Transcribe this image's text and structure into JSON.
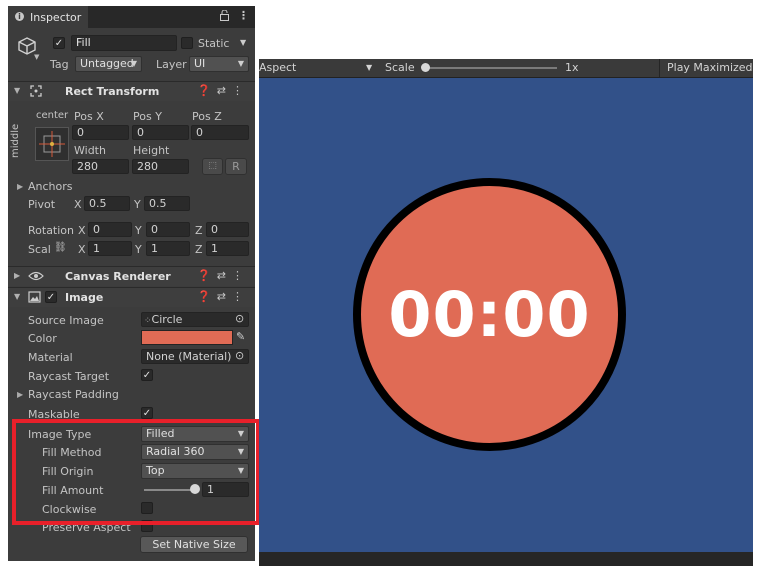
{
  "inspector": {
    "tab_title": "Inspector",
    "tab_icon": "info-icon",
    "lock_icon": "lock-icon",
    "menu_icon": "kebab-menu-icon",
    "object": {
      "name": "Fill",
      "active": true,
      "static_label": "Static",
      "static_checked": false,
      "tag_label": "Tag",
      "tag_value": "Untagged",
      "layer_label": "Layer",
      "layer_value": "UI"
    },
    "rect_transform": {
      "title": "Rect Transform",
      "anchor_h": "center",
      "anchor_v": "middle",
      "posx_label": "Pos X",
      "posy_label": "Pos Y",
      "posz_label": "Pos Z",
      "posx": "0",
      "posy": "0",
      "posz": "0",
      "width_label": "Width",
      "height_label": "Height",
      "width": "280",
      "height": "280",
      "r_button": "R",
      "anchors_label": "Anchors",
      "pivot_label": "Pivot",
      "pivot_x_label": "X",
      "pivot_x": "0.5",
      "pivot_y_label": "Y",
      "pivot_y": "0.5",
      "rotation_label": "Rotation",
      "rot_x_label": "X",
      "rot_x": "0",
      "rot_y_label": "Y",
      "rot_y": "0",
      "rot_z_label": "Z",
      "rot_z": "0",
      "scale_label": "Scal",
      "scale_x_label": "X",
      "scale_x": "1",
      "scale_y_label": "Y",
      "scale_y": "1",
      "scale_z_label": "Z",
      "scale_z": "1"
    },
    "canvas_renderer": {
      "title": "Canvas Renderer"
    },
    "image": {
      "title": "Image",
      "enabled": true,
      "source_image_label": "Source Image",
      "source_image_value": "Circle",
      "color_label": "Color",
      "color_value": "#e06b55",
      "material_label": "Material",
      "material_value": "None (Material)",
      "raycast_target_label": "Raycast Target",
      "raycast_target": true,
      "raycast_padding_label": "Raycast Padding",
      "maskable_label": "Maskable",
      "maskable": true,
      "image_type_label": "Image Type",
      "image_type_value": "Filled",
      "fill_method_label": "Fill Method",
      "fill_method_value": "Radial 360",
      "fill_origin_label": "Fill Origin",
      "fill_origin_value": "Top",
      "fill_amount_label": "Fill Amount",
      "fill_amount_value": "1",
      "fill_amount_fraction": 1.0,
      "clockwise_label": "Clockwise",
      "clockwise": false,
      "preserve_aspect_label": "Preserve Aspect",
      "set_native_size_button": "Set Native Size"
    },
    "highlight_color": "#e8202a"
  },
  "game_view": {
    "aspect_label": "Aspect",
    "scale_label": "Scale",
    "scale_value": "1x",
    "play_maximized_label": "Play Maximized",
    "background_color": "#325189",
    "timer_text": "00:00",
    "circle_fill_color": "#e06b55",
    "circle_border_color": "#000000"
  }
}
